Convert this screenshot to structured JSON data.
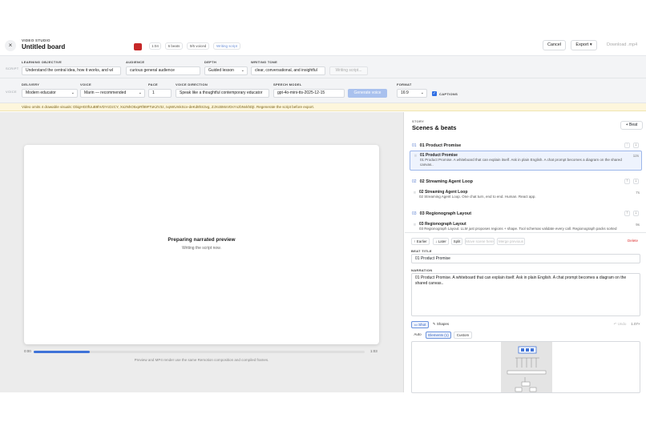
{
  "header": {
    "studio_label": "VIDEO STUDIO",
    "title": "Untitled board",
    "close_glyph": "×",
    "chips": [
      "1:04",
      "6 beats",
      "0/6 voiced",
      "Writing script"
    ],
    "cancel_label": "Cancel",
    "export_label": "Export ▾",
    "download_label": "Download .mp4"
  },
  "script_row": {
    "tag": "SCRIPT",
    "learning_objective": {
      "label": "LEARNING OBJECTIVE",
      "value": "Understand the central idea, how it works, and wl"
    },
    "audience": {
      "label": "AUDIENCE",
      "value": "curious general audience"
    },
    "depth": {
      "label": "DEPTH",
      "value": "Guided lesson"
    },
    "writing_tone": {
      "label": "WRITING TONE",
      "value": "clear, conversational, and insightful"
    },
    "writing_button": "Writing script..."
  },
  "voice_row": {
    "tag": "VOICE",
    "delivery": {
      "label": "DELIVERY",
      "value": "Modern educator"
    },
    "voice": {
      "label": "VOICE",
      "value": "Marin — recommended"
    },
    "pace": {
      "label": "PACE",
      "value": "1"
    },
    "voice_direction": {
      "label": "VOICE DIRECTION",
      "value": "Speak like a thoughtful contemporary educator"
    },
    "speech_model": {
      "label": "SPEECH MODEL",
      "value": "gpt-4o-mini-tts-2025-12-15"
    },
    "generate_label": "Generate voice",
    "format": {
      "label": "FORMAT",
      "value": "16:9"
    },
    "captions_label": "CAPTIONS",
    "captions_checked": true
  },
  "warning": "Video omits 4 drawable visuals: DbigHG0fUuB9hVDYcDzCY, Xs2NhO5xpRf89FToKZV3z, IxpWUmkScv-deKd8hS3vg, ZJXcBMxVDsYxzbNvkhDjt. Regenerate the script before export.",
  "preview": {
    "title": "Preparing narrated preview",
    "subtitle": "Writing the script now.",
    "time_start": "0:00",
    "time_end": "1:03",
    "progress": 0.17,
    "footnote": "Preview and MP4 render use the same Remotion composition and compiled frames."
  },
  "story": {
    "label": "STORY",
    "title": "Scenes & beats",
    "add_beat": "+ Beat",
    "scenes": [
      {
        "num": "01",
        "title": "01 Product Promise",
        "beat_title": "01 Product Promise",
        "beat_desc": "01 Product Promise. A whiteboard that can explain itself. Ask in plain English. A chat prompt becomes a diagram on the shared canvas..",
        "duration": "12s",
        "active": true
      },
      {
        "num": "02",
        "title": "02 Streaming Agent Loop",
        "beat_title": "02 Streaming Agent Loop",
        "beat_desc": "02 Streaming Agent Loop. One chat turn, end to end. Human. React app.",
        "duration": "7s",
        "active": false
      },
      {
        "num": "03",
        "title": "03 Regionograph Layout",
        "beat_title": "03 Regionograph Layout",
        "beat_desc": "03 Regionograph Layout. LLM just proposes regions + shape. Tool schemas validate every call. Regionograph packs sorted",
        "duration": "9s",
        "active": false
      }
    ]
  },
  "editor": {
    "earlier": "↑ Earlier",
    "later": "↓ Later",
    "split": "Split",
    "move_scene": "Move scene here",
    "merge_previous": "Merge previous",
    "delete": "Delete",
    "beat_title_label": "BEAT TITLE",
    "beat_title_value": "01 Product Promise",
    "narration_label": "NARRATION",
    "narration_value": "01 Product Promise. A whiteboard that can explain itself. Ask in plain English. A chat prompt becomes a diagram on the shared canvas..",
    "shot_tab": "▭ Shot",
    "shapes_tab": "✎ Shapes",
    "undo": "↶ Undo",
    "zoom": "1.07×",
    "auto": "Auto",
    "elements": "Elements (1)",
    "custom": "Custom"
  }
}
